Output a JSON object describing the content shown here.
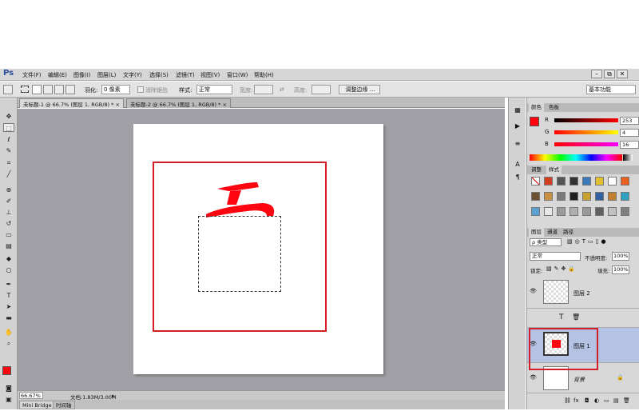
{
  "app": {
    "logo": "Ps"
  },
  "menu": [
    "文件(F)",
    "编辑(E)",
    "图像(I)",
    "图层(L)",
    "文字(Y)",
    "选择(S)",
    "滤镜(T)",
    "视图(V)",
    "窗口(W)",
    "帮助(H)"
  ],
  "window_controls": {
    "minimize": "–",
    "restore": "⧉",
    "close": "✕"
  },
  "options": {
    "feather_label": "羽化:",
    "feather_value": "0 像素",
    "antialias_label": "消除锯齿",
    "style_label": "样式:",
    "style_value": "正常",
    "width_label": "宽度:",
    "height_label": "高度:",
    "swap_icon": "⇄",
    "refine_button": "调整边缘 ...",
    "workspace_value": "基本功能"
  },
  "documents": [
    {
      "title": "未标题-1 @ 66.7% (图层 1, RGB/8) *",
      "close": "×"
    },
    {
      "title": "未标题-2 @ 66.7% (图层 1, RGB/8) *",
      "close": "×"
    }
  ],
  "tools": [
    "move",
    "marquee",
    "lasso",
    "quick-select",
    "crop",
    "eyedropper",
    "healing",
    "brush",
    "stamp",
    "history-brush",
    "eraser",
    "gradient",
    "blur",
    "dodge",
    "pen",
    "type",
    "path-select",
    "shape",
    "hand",
    "zoom",
    "color-swap",
    "quick-mask",
    "screen-mode"
  ],
  "status": {
    "zoom": "66.67%",
    "doc_info": "文档:1.83M/3.00M"
  },
  "bottom_tabs": [
    "Mini Bridge",
    "时间轴"
  ],
  "color_panel": {
    "tabs": [
      "颜色",
      "色板"
    ],
    "channels": [
      {
        "label": "R",
        "value": "253"
      },
      {
        "label": "G",
        "value": "4"
      },
      {
        "label": "B",
        "value": "16"
      }
    ],
    "foreground": "#fd0410",
    "background": "#ffffff"
  },
  "styles_panel": {
    "tabs": [
      "调整",
      "样式"
    ]
  },
  "layers_panel": {
    "tabs": [
      "图层",
      "通道",
      "路径"
    ],
    "filter_label": "ρ 类型",
    "blend_mode": "正常",
    "opacity_label": "不透明度:",
    "opacity_value": "100%",
    "lock_label": "锁定:",
    "fill_label": "填充:",
    "fill_value": "100%",
    "layers": [
      {
        "name": "图层 2",
        "selected": false
      },
      {
        "name": "图层 1",
        "selected": true
      },
      {
        "name": "背景",
        "selected": false
      }
    ],
    "type_glyph": "T",
    "trash_glyph": "🗑",
    "lock_glyph": "🔒",
    "footer_icons": [
      "⛓",
      "fx",
      "◘",
      "◐",
      "▭",
      "▤",
      "🗑"
    ]
  },
  "colors": {
    "accent_red": "#d21e26",
    "selection_blue": "#b4c3e4"
  }
}
